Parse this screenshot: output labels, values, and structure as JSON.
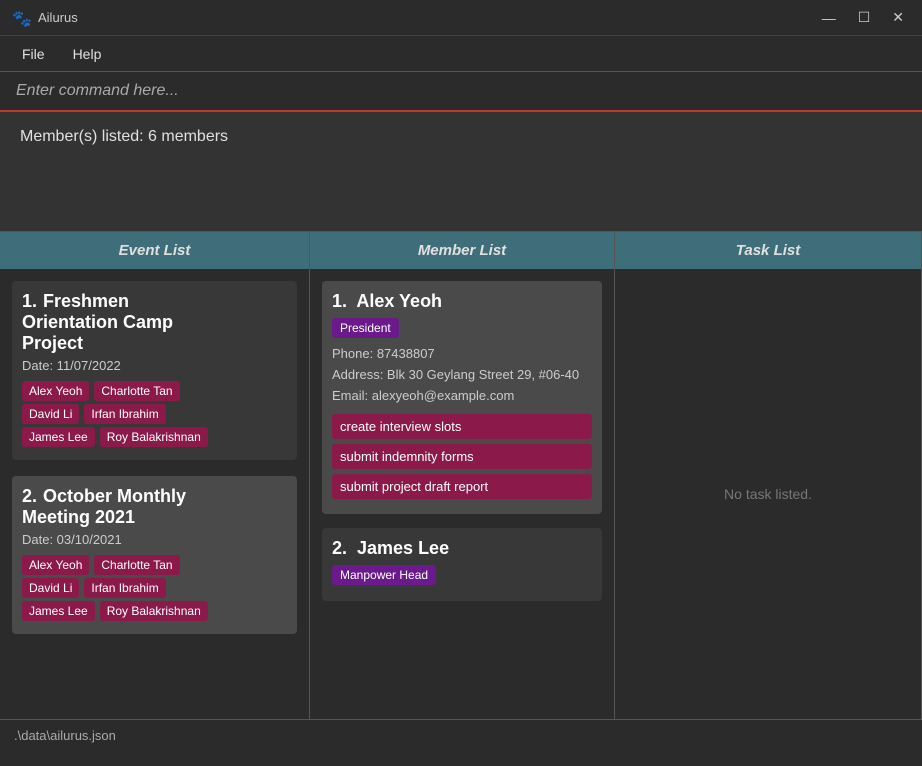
{
  "titleBar": {
    "icon": "🐾",
    "title": "Ailurus",
    "minimize": "—",
    "maximize": "☐",
    "close": "✕"
  },
  "menuBar": {
    "items": [
      "File",
      "Help"
    ]
  },
  "commandBar": {
    "placeholder": "Enter command here..."
  },
  "statusArea": {
    "text": "Member(s) listed: 6 members"
  },
  "panels": {
    "event": {
      "header": "Event List",
      "events": [
        {
          "number": "1.",
          "title": "Freshmen\nOrientation Camp\nProject",
          "date": "Date: 11/07/2022",
          "tags": [
            "Alex Yeoh",
            "Charlotte Tan",
            "David Li",
            "Irfan Ibrahim",
            "James Lee",
            "Roy Balakrishnan"
          ]
        },
        {
          "number": "2.",
          "title": "October Monthly\nMeeting 2021",
          "date": "Date: 03/10/2021",
          "tags": [
            "Alex Yeoh",
            "Charlotte Tan",
            "David Li",
            "Irfan Ibrahim",
            "James Lee",
            "Roy Balakrishnan"
          ]
        }
      ]
    },
    "member": {
      "header": "Member List",
      "members": [
        {
          "number": "1.",
          "name": "Alex Yeoh",
          "role": "President",
          "phone": "Phone: 87438807",
          "address": "Address: Blk 30 Geylang Street 29, #06-40",
          "email": "Email: alexyeoh@example.com",
          "tasks": [
            "create interview slots",
            "submit indemnity forms",
            "submit project draft report"
          ]
        },
        {
          "number": "2.",
          "name": "James Lee",
          "role": "Manpower Head",
          "phone": "",
          "address": "",
          "email": "",
          "tasks": []
        }
      ]
    },
    "task": {
      "header": "Task List",
      "emptyText": "No task listed."
    }
  },
  "bottomStatus": {
    "path": ".\\data\\ailurus.json"
  }
}
